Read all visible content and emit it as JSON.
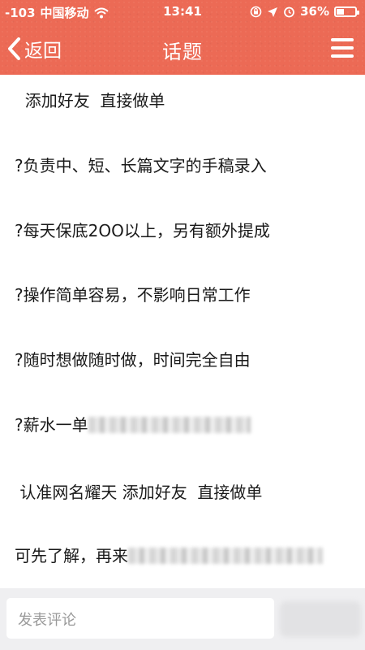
{
  "status_bar": {
    "signal": "-103",
    "carrier": "中国移动",
    "time": "13:41",
    "battery": "36%",
    "battery_level": 0.36
  },
  "nav": {
    "back_label": "返回",
    "title": "话题"
  },
  "post": {
    "lines": [
      "  添加好友  直接做单",
      "?负责中、短、长篇文字的手稿录入",
      "?每天保底2OO以上，另有额外提成",
      "?操作简单容易，不影响日常工作",
      "?随时想做随时做，时间完全自由",
      "?薪水一单",
      " 认准网名耀天 添加好友  直接做单",
      "可先了解，再来"
    ]
  },
  "comment": {
    "placeholder": "发表评论"
  },
  "colors": {
    "header": "#ec6a55",
    "bar": "#efeff1"
  }
}
